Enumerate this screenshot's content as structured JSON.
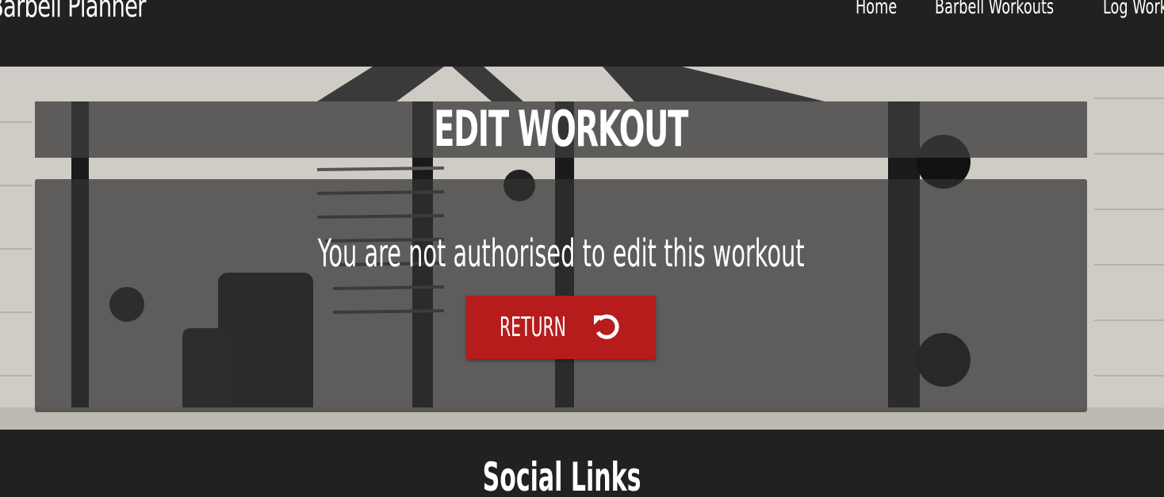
{
  "navbar": {
    "brand": "Barbell Planner",
    "links": [
      {
        "label": "Home"
      },
      {
        "label": "Barbell Workouts"
      },
      {
        "label": "Log Workout"
      }
    ]
  },
  "main": {
    "title": "EDIT WORKOUT",
    "message": "You are not authorised to edit this workout",
    "return_button": {
      "label": "RETURN",
      "icon": "refresh-icon"
    }
  },
  "footer": {
    "title": "Social Links"
  },
  "colors": {
    "background": "#212121",
    "button": "#b71c1c",
    "text": "#ffffff"
  }
}
